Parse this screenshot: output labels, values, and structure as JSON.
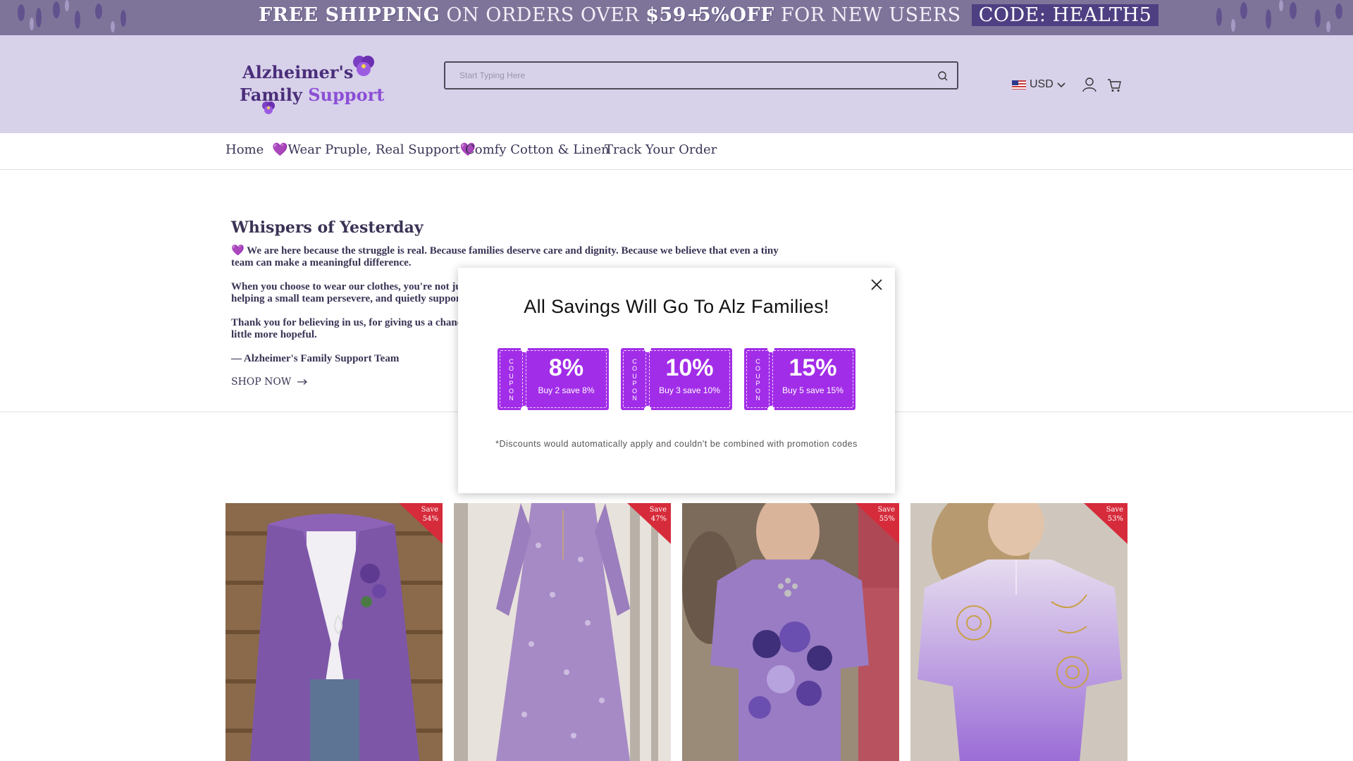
{
  "announcement": {
    "msg1_bold": "FREE SHIPPING",
    "msg1_rest": " ON ORDERS OVER ",
    "msg1_amount": "$59+",
    "msg2_bold": "5%OFF",
    "msg2_rest": " FOR NEW USERS ",
    "msg2_code": "CODE: HEALTH5"
  },
  "header": {
    "logo_line1": "Alzheimer's",
    "logo_line2a": "Family ",
    "logo_line2b": "Support",
    "search_placeholder": "Start Typing Here",
    "currency": "USD",
    "icons": [
      "search-icon",
      "flag-us-icon",
      "chevron-down-icon",
      "account-icon",
      "cart-icon"
    ]
  },
  "nav": {
    "items": [
      {
        "label": "Home"
      },
      {
        "heart_left": "💜",
        "label": "Wear Pruple, Real Support",
        "heart_right": "💜"
      },
      {
        "label": "Comfy Cotton & Linen"
      },
      {
        "label": "Track Your Order"
      }
    ]
  },
  "intro": {
    "title": "Whispers of Yesterday",
    "p1_heart": "💜",
    "p1": " We are here because the struggle is real. Because families deserve care and dignity. Because we believe that even a tiny team can make a meaningful difference.",
    "p2": "When you choose to wear our clothes, you're not just buying something to wear—you're showing up for families in need, helping a small team persevere, and quietly supporting someone else.",
    "p3": "Thank you for believing in us, for giving us a chance to stand with families in need, and for helping make the world feel a little more hopeful.",
    "p4": "— Alzheimer's Family Support Team",
    "shop_now": "SHOP NOW"
  },
  "products": [
    {
      "save_label": "Save",
      "save_pct": "54%"
    },
    {
      "save_label": "Save",
      "save_pct": "47%"
    },
    {
      "save_label": "Save",
      "save_pct": "55%"
    },
    {
      "save_label": "Save",
      "save_pct": "53%"
    }
  ],
  "modal": {
    "title": "All Savings Will Go To Alz Families!",
    "coupons": [
      {
        "stub": [
          "C",
          "O",
          "U",
          "P",
          "O",
          "N"
        ],
        "pct": "8%",
        "desc": "Buy 2 save 8%"
      },
      {
        "stub": [
          "C",
          "O",
          "U",
          "P",
          "O",
          "N"
        ],
        "pct": "10%",
        "desc": "Buy 3 save 10%"
      },
      {
        "stub": [
          "C",
          "O",
          "U",
          "P",
          "O",
          "N"
        ],
        "pct": "15%",
        "desc": "Buy 5 save 15%"
      }
    ],
    "note": "*Discounts would automatically apply and couldn't be combined with promotion codes"
  },
  "colors": {
    "announcement_bg": "#7e7499",
    "header_bg": "#d8d1ea",
    "coupon_purple": "#a22de8",
    "badge_red": "#d62b3b",
    "nav_text": "#3b3355"
  }
}
